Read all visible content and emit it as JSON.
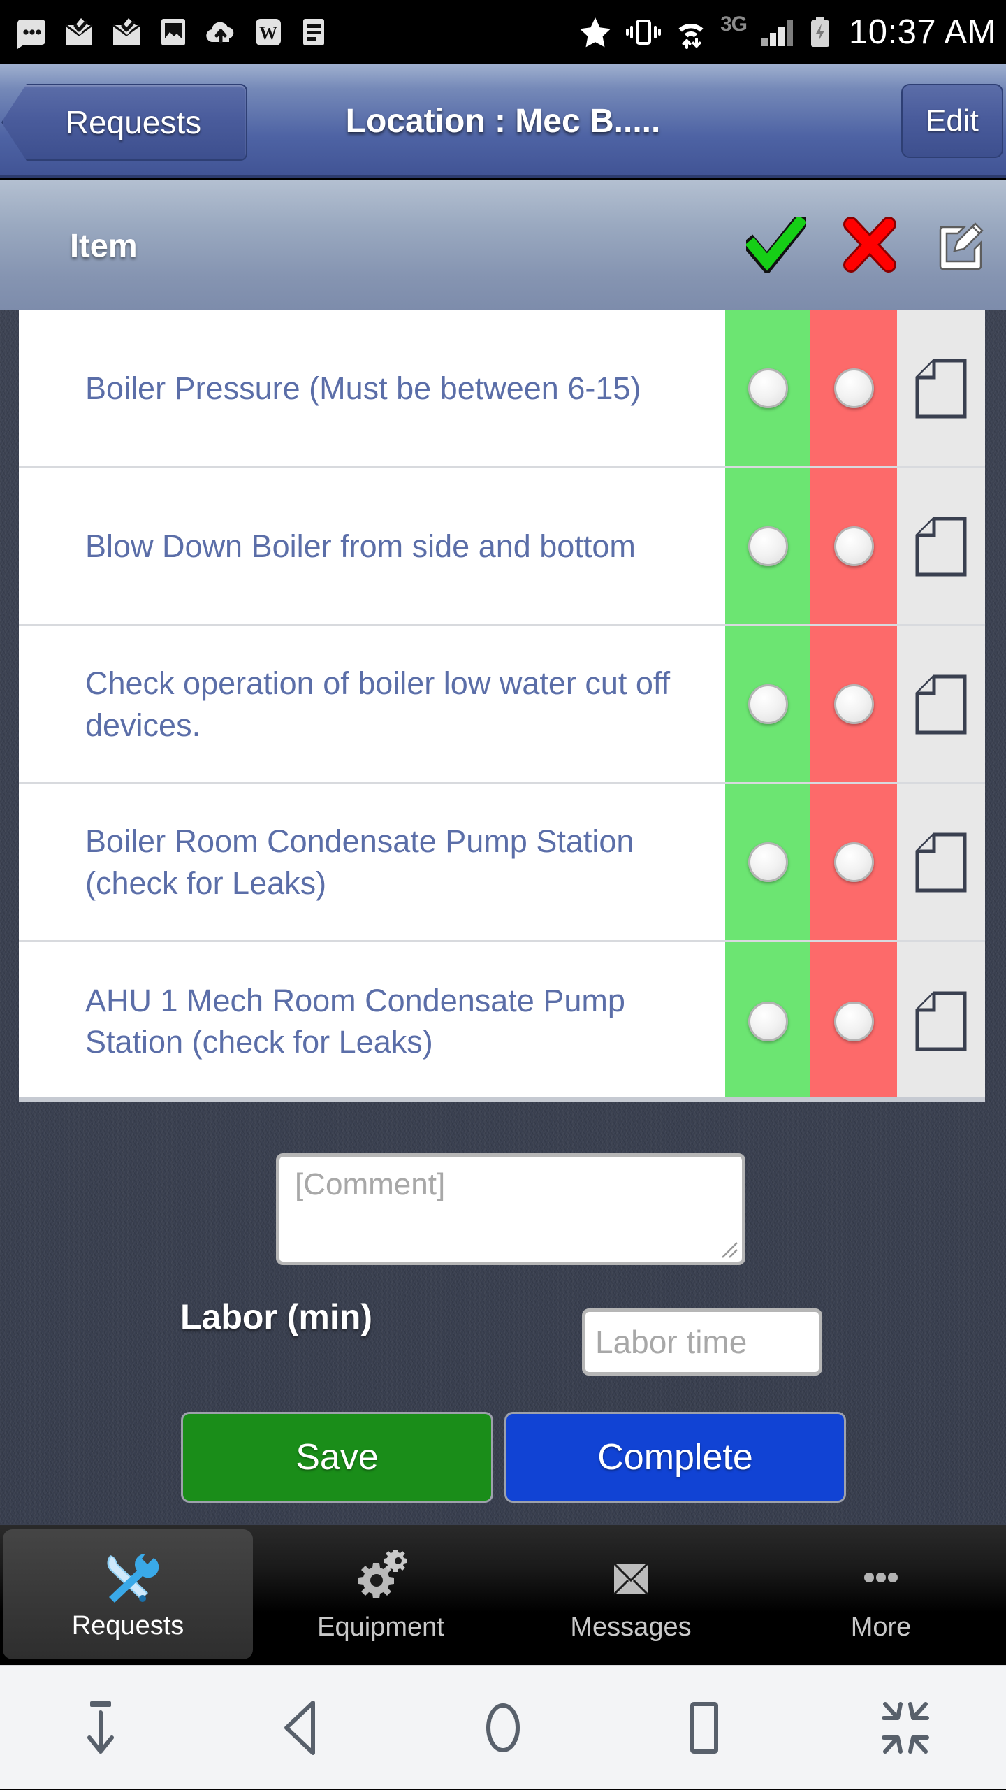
{
  "statusbar": {
    "time": "10:37 AM",
    "network_label": "3G",
    "icons_left": [
      "more-dots-icon",
      "mail-check-icon",
      "mail-check-icon",
      "gallery-image-icon",
      "cloud-upload-icon",
      "word-doc-icon",
      "text-doc-icon"
    ],
    "icons_right": [
      "star-icon",
      "vibrate-icon",
      "wifi-transfer-icon",
      "signal-bars-icon",
      "battery-charging-icon"
    ]
  },
  "navbar": {
    "back_label": "Requests",
    "title": "Location : Mec B.....",
    "edit_label": "Edit"
  },
  "table": {
    "header": {
      "item_label": "Item",
      "ok_icon": "green-check-icon",
      "fail_icon": "red-x-icon",
      "note_icon": "edit-note-icon"
    },
    "rows": [
      {
        "label": "Boiler Pressure (Must be between 6-15)"
      },
      {
        "label": "Blow Down Boiler from side and bottom"
      },
      {
        "label": "Check operation of boiler low water cut off devices."
      },
      {
        "label": "Boiler Room Condensate Pump Station (check for Leaks)"
      },
      {
        "label": "AHU 1 Mech Room Condensate Pump Station (check for Leaks)"
      }
    ]
  },
  "form": {
    "comment_placeholder": "[Comment]",
    "labor_label": "Labor (min)",
    "labor_placeholder": "Labor time",
    "save_label": "Save",
    "complete_label": "Complete"
  },
  "tabbar": {
    "items": [
      {
        "label": "Requests",
        "icon": "tools-icon",
        "active": true
      },
      {
        "label": "Equipment",
        "icon": "gears-icon",
        "active": false
      },
      {
        "label": "Messages",
        "icon": "envelope-icon",
        "active": false
      },
      {
        "label": "More",
        "icon": "more-dots-icon",
        "active": false
      }
    ]
  },
  "androidnav": {
    "buttons": [
      "hide-keyboard-icon",
      "back-icon",
      "home-icon",
      "recents-icon",
      "shrink-screen-icon"
    ]
  },
  "colors": {
    "ok_column": "#6CE572",
    "fail_column": "#FD6A6A",
    "note_column": "#E8E8E8",
    "row_text": "#5B6EA8",
    "save_button": "#1A8D19",
    "complete_button": "#1143D4",
    "page_background": "#3C4252",
    "navbar": "#4E63A4"
  }
}
